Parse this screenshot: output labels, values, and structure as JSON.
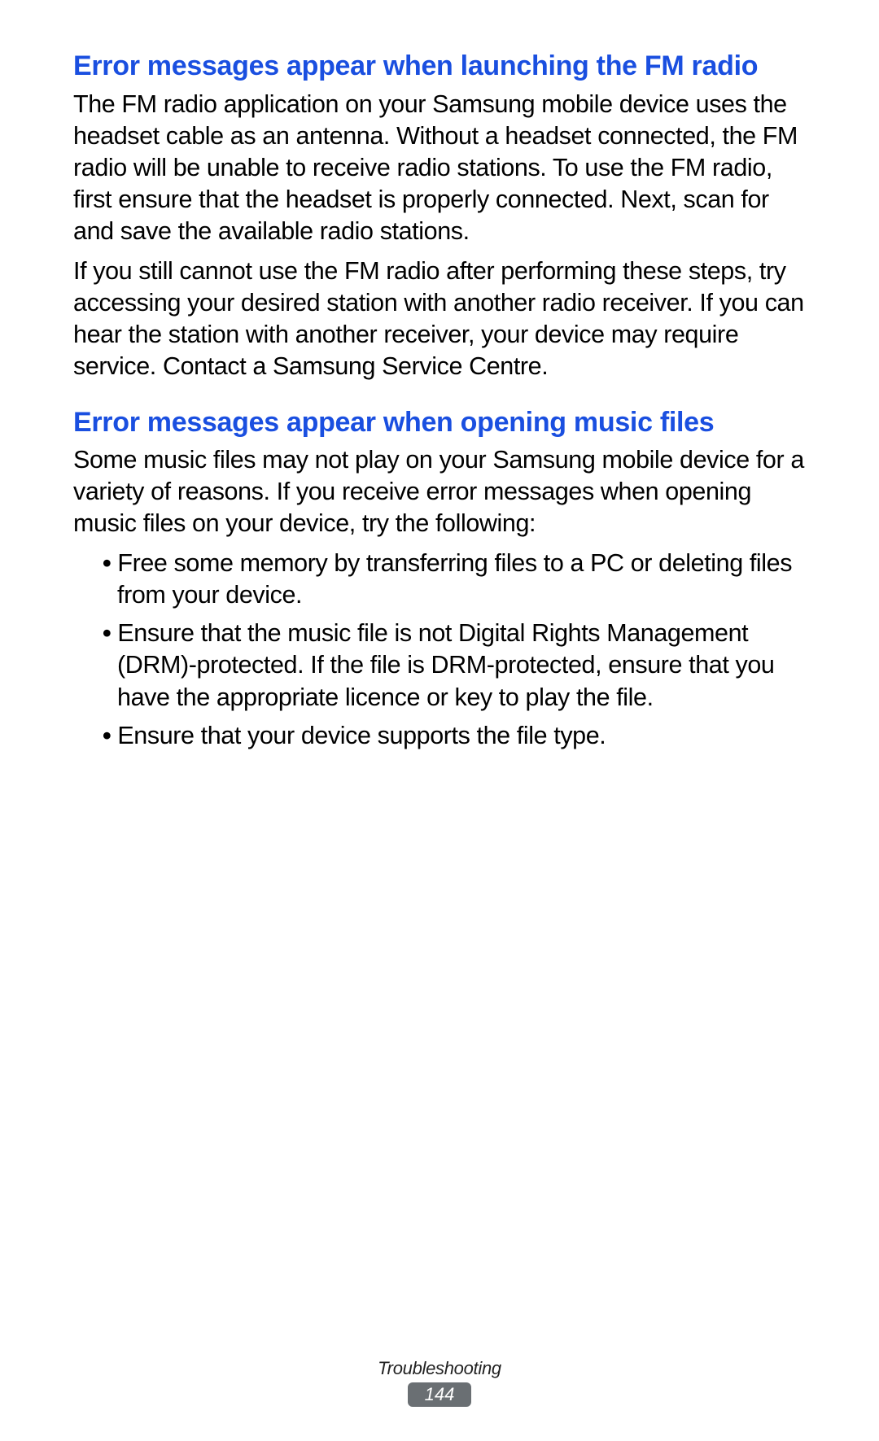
{
  "sections": [
    {
      "heading": "Error messages appear when launching the FM radio",
      "paragraphs": [
        "The FM radio application on your Samsung mobile device uses the headset cable as an antenna. Without a headset connected, the FM radio will be unable to receive radio stations. To use the FM radio, first ensure that the headset is properly connected. Next, scan for and save the available radio stations.",
        "If you still cannot use the FM radio after performing these steps, try accessing your desired station with another radio receiver. If you can hear the station with another receiver, your device may require service. Contact a Samsung Service Centre."
      ],
      "bullets": []
    },
    {
      "heading": "Error messages appear when opening music files",
      "paragraphs": [
        "Some music files may not play on your Samsung mobile device for a variety of reasons. If you receive error messages when opening music files on your device, try the following:"
      ],
      "bullets": [
        "Free some memory by transferring files to a PC or deleting files from your device.",
        "Ensure that the music file is not Digital Rights Management (DRM)-protected. If the file is DRM-protected, ensure that you have the appropriate licence or key to play the file.",
        "Ensure that your device supports the file type."
      ]
    }
  ],
  "footer": {
    "section_name": "Troubleshooting",
    "page_number": "144"
  }
}
